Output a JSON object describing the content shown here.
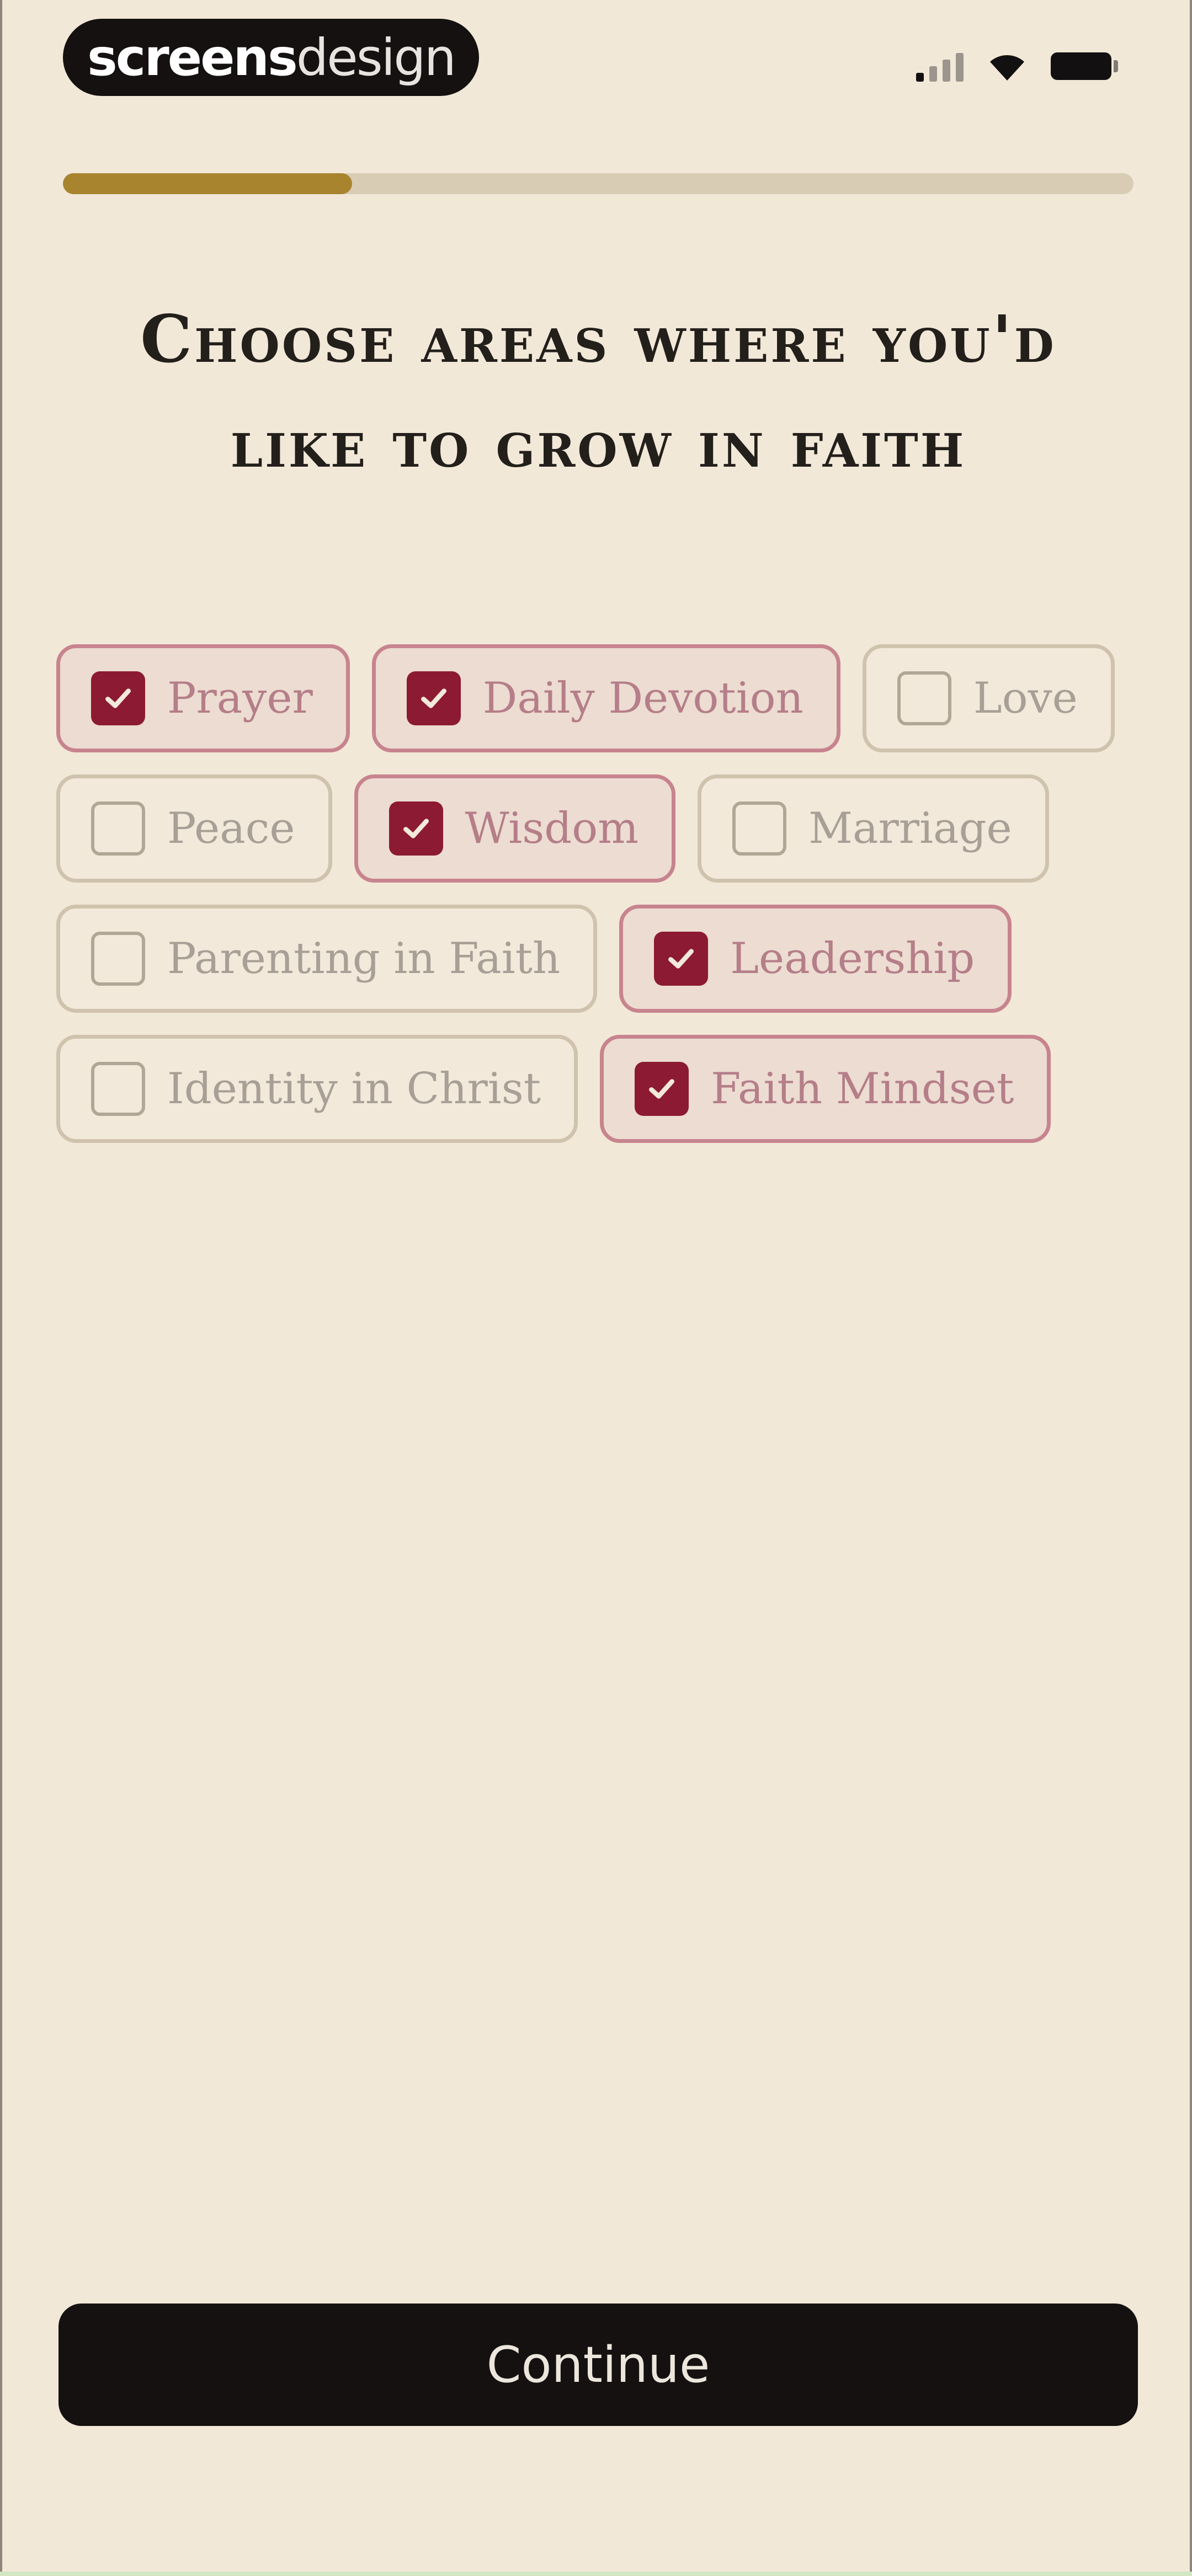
{
  "status_bar": {
    "brand_part1": "screens",
    "brand_part2": "design"
  },
  "progress": {
    "fraction": 0.27
  },
  "title": "Choose areas where you'd like to grow in faith",
  "chips": [
    [
      {
        "label": "Prayer",
        "selected": true
      },
      {
        "label": "Daily Devotion",
        "selected": true
      },
      {
        "label": "Love",
        "selected": false
      }
    ],
    [
      {
        "label": "Peace",
        "selected": false
      },
      {
        "label": "Wisdom",
        "selected": true
      },
      {
        "label": "Marriage",
        "selected": false
      }
    ],
    [
      {
        "label": "Parenting in Faith",
        "selected": false
      },
      {
        "label": "Leadership",
        "selected": true
      }
    ],
    [
      {
        "label": "Identity in Christ",
        "selected": false
      },
      {
        "label": "Faith Mindset",
        "selected": true
      }
    ]
  ],
  "continue_label": "Continue",
  "colors": {
    "background": "#f2e8d8",
    "accent_gold": "#a8842f",
    "selected_checkbox": "#8c1a33",
    "selected_border": "#c7848f",
    "button": "#141110"
  }
}
